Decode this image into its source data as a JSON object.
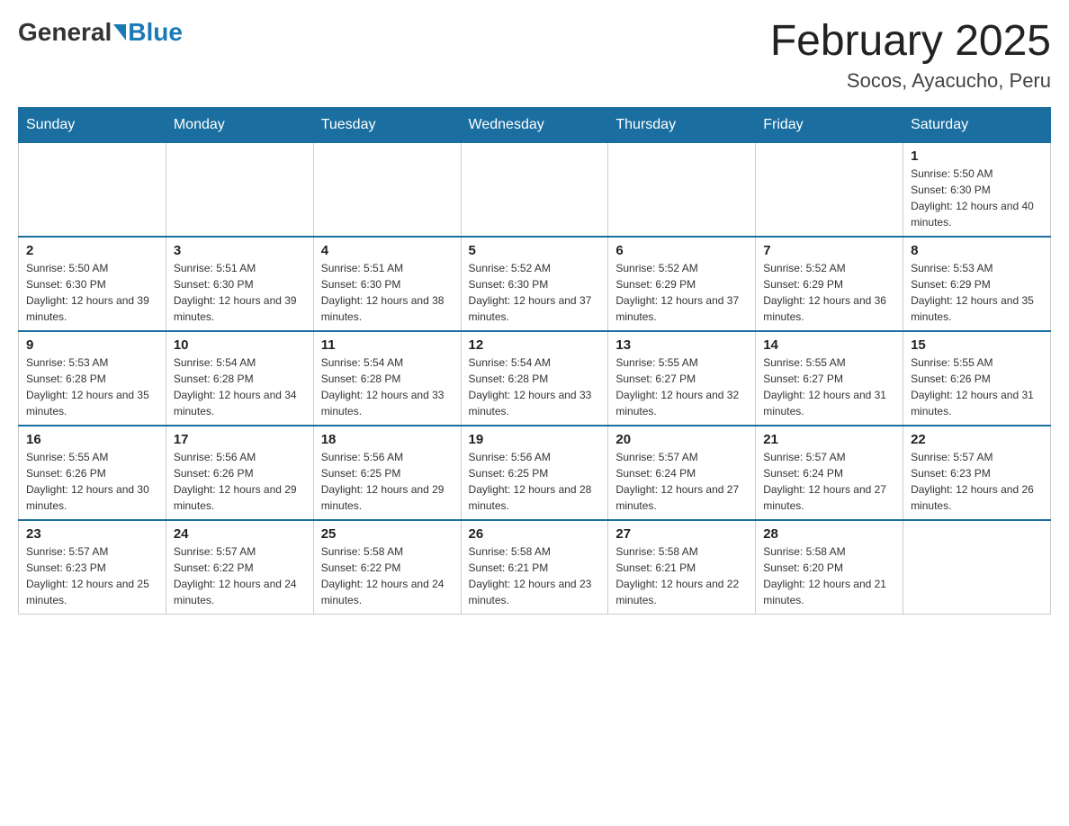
{
  "header": {
    "logo_general": "General",
    "logo_blue": "Blue",
    "month_title": "February 2025",
    "location": "Socos, Ayacucho, Peru"
  },
  "weekdays": [
    "Sunday",
    "Monday",
    "Tuesday",
    "Wednesday",
    "Thursday",
    "Friday",
    "Saturday"
  ],
  "weeks": [
    [
      {
        "day": "",
        "info": ""
      },
      {
        "day": "",
        "info": ""
      },
      {
        "day": "",
        "info": ""
      },
      {
        "day": "",
        "info": ""
      },
      {
        "day": "",
        "info": ""
      },
      {
        "day": "",
        "info": ""
      },
      {
        "day": "1",
        "info": "Sunrise: 5:50 AM\nSunset: 6:30 PM\nDaylight: 12 hours and 40 minutes."
      }
    ],
    [
      {
        "day": "2",
        "info": "Sunrise: 5:50 AM\nSunset: 6:30 PM\nDaylight: 12 hours and 39 minutes."
      },
      {
        "day": "3",
        "info": "Sunrise: 5:51 AM\nSunset: 6:30 PM\nDaylight: 12 hours and 39 minutes."
      },
      {
        "day": "4",
        "info": "Sunrise: 5:51 AM\nSunset: 6:30 PM\nDaylight: 12 hours and 38 minutes."
      },
      {
        "day": "5",
        "info": "Sunrise: 5:52 AM\nSunset: 6:30 PM\nDaylight: 12 hours and 37 minutes."
      },
      {
        "day": "6",
        "info": "Sunrise: 5:52 AM\nSunset: 6:29 PM\nDaylight: 12 hours and 37 minutes."
      },
      {
        "day": "7",
        "info": "Sunrise: 5:52 AM\nSunset: 6:29 PM\nDaylight: 12 hours and 36 minutes."
      },
      {
        "day": "8",
        "info": "Sunrise: 5:53 AM\nSunset: 6:29 PM\nDaylight: 12 hours and 35 minutes."
      }
    ],
    [
      {
        "day": "9",
        "info": "Sunrise: 5:53 AM\nSunset: 6:28 PM\nDaylight: 12 hours and 35 minutes."
      },
      {
        "day": "10",
        "info": "Sunrise: 5:54 AM\nSunset: 6:28 PM\nDaylight: 12 hours and 34 minutes."
      },
      {
        "day": "11",
        "info": "Sunrise: 5:54 AM\nSunset: 6:28 PM\nDaylight: 12 hours and 33 minutes."
      },
      {
        "day": "12",
        "info": "Sunrise: 5:54 AM\nSunset: 6:28 PM\nDaylight: 12 hours and 33 minutes."
      },
      {
        "day": "13",
        "info": "Sunrise: 5:55 AM\nSunset: 6:27 PM\nDaylight: 12 hours and 32 minutes."
      },
      {
        "day": "14",
        "info": "Sunrise: 5:55 AM\nSunset: 6:27 PM\nDaylight: 12 hours and 31 minutes."
      },
      {
        "day": "15",
        "info": "Sunrise: 5:55 AM\nSunset: 6:26 PM\nDaylight: 12 hours and 31 minutes."
      }
    ],
    [
      {
        "day": "16",
        "info": "Sunrise: 5:55 AM\nSunset: 6:26 PM\nDaylight: 12 hours and 30 minutes."
      },
      {
        "day": "17",
        "info": "Sunrise: 5:56 AM\nSunset: 6:26 PM\nDaylight: 12 hours and 29 minutes."
      },
      {
        "day": "18",
        "info": "Sunrise: 5:56 AM\nSunset: 6:25 PM\nDaylight: 12 hours and 29 minutes."
      },
      {
        "day": "19",
        "info": "Sunrise: 5:56 AM\nSunset: 6:25 PM\nDaylight: 12 hours and 28 minutes."
      },
      {
        "day": "20",
        "info": "Sunrise: 5:57 AM\nSunset: 6:24 PM\nDaylight: 12 hours and 27 minutes."
      },
      {
        "day": "21",
        "info": "Sunrise: 5:57 AM\nSunset: 6:24 PM\nDaylight: 12 hours and 27 minutes."
      },
      {
        "day": "22",
        "info": "Sunrise: 5:57 AM\nSunset: 6:23 PM\nDaylight: 12 hours and 26 minutes."
      }
    ],
    [
      {
        "day": "23",
        "info": "Sunrise: 5:57 AM\nSunset: 6:23 PM\nDaylight: 12 hours and 25 minutes."
      },
      {
        "day": "24",
        "info": "Sunrise: 5:57 AM\nSunset: 6:22 PM\nDaylight: 12 hours and 24 minutes."
      },
      {
        "day": "25",
        "info": "Sunrise: 5:58 AM\nSunset: 6:22 PM\nDaylight: 12 hours and 24 minutes."
      },
      {
        "day": "26",
        "info": "Sunrise: 5:58 AM\nSunset: 6:21 PM\nDaylight: 12 hours and 23 minutes."
      },
      {
        "day": "27",
        "info": "Sunrise: 5:58 AM\nSunset: 6:21 PM\nDaylight: 12 hours and 22 minutes."
      },
      {
        "day": "28",
        "info": "Sunrise: 5:58 AM\nSunset: 6:20 PM\nDaylight: 12 hours and 21 minutes."
      },
      {
        "day": "",
        "info": ""
      }
    ]
  ]
}
